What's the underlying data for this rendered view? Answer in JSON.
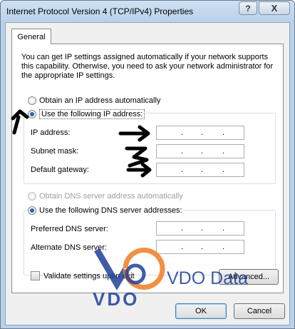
{
  "window": {
    "title": "Internet Protocol Version 4 (TCP/IPv4) Properties",
    "help_glyph": "?",
    "close_glyph": "X"
  },
  "tabs": [
    {
      "label": "General"
    }
  ],
  "description": "You can get IP settings assigned automatically if your network supports this capability. Otherwise, you need to ask your network administrator for the appropriate IP settings.",
  "ip": {
    "auto_label": "Obtain an IP address automatically",
    "manual_label": "Use the following IP address:",
    "fields": [
      {
        "label": "IP address:",
        "value": ". . ."
      },
      {
        "label": "Subnet mask:",
        "value": ". . ."
      },
      {
        "label": "Default gateway:",
        "value": ". . ."
      }
    ]
  },
  "dns": {
    "auto_label": "Obtain DNS server address automatically",
    "manual_label": "Use the following DNS server addresses:",
    "fields": [
      {
        "label": "Preferred DNS server:",
        "value": ". . ."
      },
      {
        "label": "Alternate DNS server:",
        "value": ". . ."
      }
    ]
  },
  "validate_label": "Validate settings upon exit",
  "advanced_label": "Advanced...",
  "ok_label": "OK",
  "cancel_label": "Cancel",
  "watermark": {
    "logo_text": "VDO",
    "brand_text": "VDO Data"
  },
  "colors": {
    "accent": "#2d64b9",
    "watermark_blue": "#1f3f9a",
    "watermark_orange": "#f07d22"
  },
  "icons": [
    "help-icon",
    "close-icon",
    "arrow-annotation-icon"
  ]
}
